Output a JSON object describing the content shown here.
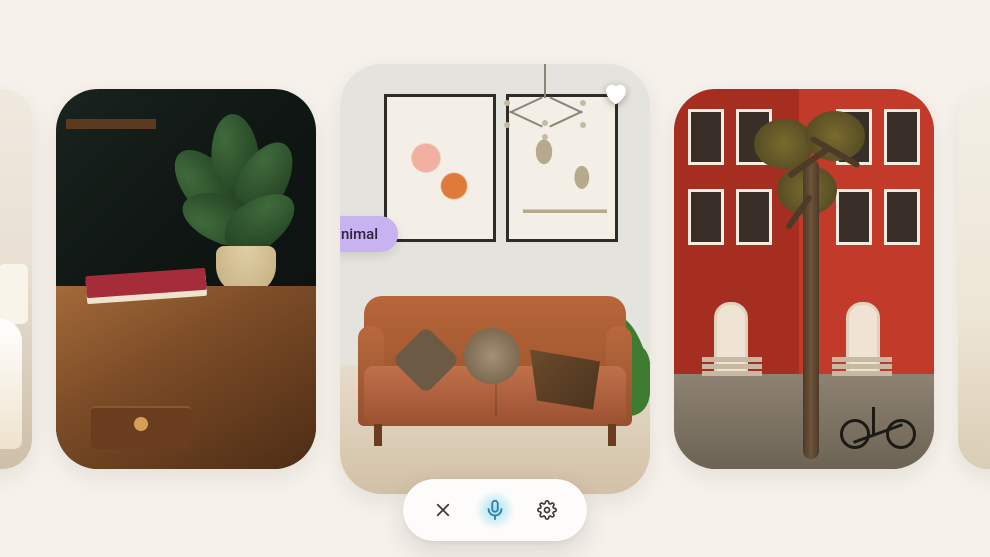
{
  "carousel": {
    "cards": [
      {
        "name": "peek-left-card",
        "alt": "light interior edge"
      },
      {
        "name": "desk-plant-card",
        "alt": "wooden desk with plant against dark green wall"
      },
      {
        "name": "sofa-card",
        "alt": "minimal living room with tan leather sofa",
        "favorite": false,
        "tag": "Minimal"
      },
      {
        "name": "townhouse-card",
        "alt": "red brick townhouses with tree and bicycle"
      },
      {
        "name": "peek-right-card",
        "alt": "light interior edge"
      }
    ]
  },
  "controls": {
    "close_label": "Close",
    "mic_label": "Voice",
    "settings_label": "Settings"
  },
  "colors": {
    "tag_bg": "#c9b2f0",
    "accent_glow": "#58c8ea"
  }
}
